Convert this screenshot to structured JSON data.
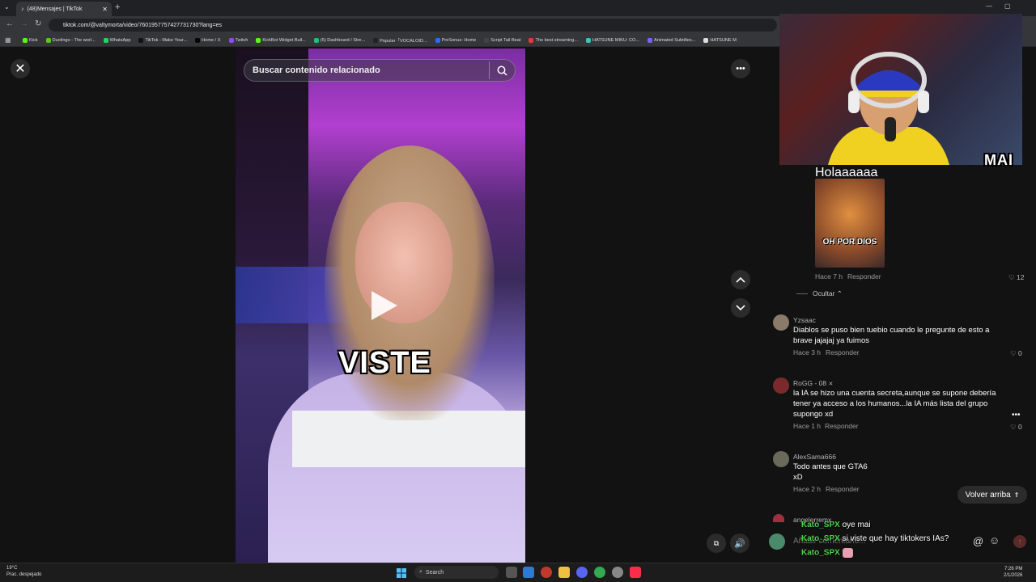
{
  "browser": {
    "tab_title": "(48)Mensajes | TikTok",
    "url": "tiktok.com/@valtymorta/video/7601957757427731730?lang=es",
    "bookmarks": [
      {
        "label": "Kick",
        "color": "#53fc18"
      },
      {
        "label": "Duolingo - The worl...",
        "color": "#58cc02"
      },
      {
        "label": "WhatsApp",
        "color": "#25d366"
      },
      {
        "label": "TikTok - Make Your...",
        "color": "#111111"
      },
      {
        "label": "Home / X",
        "color": "#000000"
      },
      {
        "label": "Twitch",
        "color": "#9146ff"
      },
      {
        "label": "KickBot Widget Buil...",
        "color": "#53fc18"
      },
      {
        "label": "(5) Dashboard / Stre...",
        "color": "#19c37d"
      },
      {
        "label": "Popular「VOCALOID...",
        "color": "#222222"
      },
      {
        "label": "PreSonus: Home",
        "color": "#2a6cff"
      },
      {
        "label": "Script Tail Beat",
        "color": "#444444"
      },
      {
        "label": "The best streaming...",
        "color": "#e53935"
      },
      {
        "label": "HATSUNE MIKU: CO...",
        "color": "#39c5bb"
      },
      {
        "label": "Animated Subtitles...",
        "color": "#7b61ff"
      },
      {
        "label": "HATSUNE M",
        "color": "#dddddd"
      }
    ]
  },
  "video": {
    "search_placeholder": "Buscar contenido relacionado",
    "caption": "VISTE"
  },
  "comments": {
    "reply_text": "Holaaaaaa",
    "reply_image_label": "OH POR DIOS",
    "reply_meta": "Hace 7 h",
    "reply_label": "Responder",
    "reply_likes": "12",
    "hide_label": "Ocultar",
    "items": [
      {
        "user": "Yzsaac",
        "text_line1": "Diablos se puso bien tuebio cuando le pregunte de esto a",
        "text_line2": "brave jajajaj ya fuimos",
        "text_line3": "",
        "time": "Hace 3 h",
        "reply": "Responder",
        "likes": "0"
      },
      {
        "user": "RoGG - 08",
        "text_line1": "la IA se hizo una cuenta secreta,aunque se supone debería",
        "text_line2": "tener ya acceso a los humanos...la IA más lista del grupo",
        "text_line3": "supongo xd",
        "time": "Hace 1 h",
        "reply": "Responder",
        "likes": "0"
      },
      {
        "user": "AlexSama666",
        "text_line1": "Todo antes que GTA6",
        "text_line2": "xD",
        "text_line3": "",
        "time": "Hace 2 h",
        "reply": "Responder",
        "likes": ""
      }
    ],
    "partial_user": "angelerremx",
    "back_to_top": "Volver arriba",
    "input_placeholder": "Añadir comentario..."
  },
  "chat_overlay": [
    {
      "name": "Kato_SPX",
      "message": "oye mai"
    },
    {
      "name": "Kato_SPX",
      "message": "si viste que hay tiktokers IAs?"
    },
    {
      "name": "Kato_SPX",
      "message": ""
    }
  ],
  "webcam": {
    "overlay_text": "MAI"
  },
  "taskbar": {
    "temp": "19°C",
    "weather": "Prac. despejado",
    "search": "Search",
    "time": "7:26 PM",
    "date": "2/1/2026"
  }
}
